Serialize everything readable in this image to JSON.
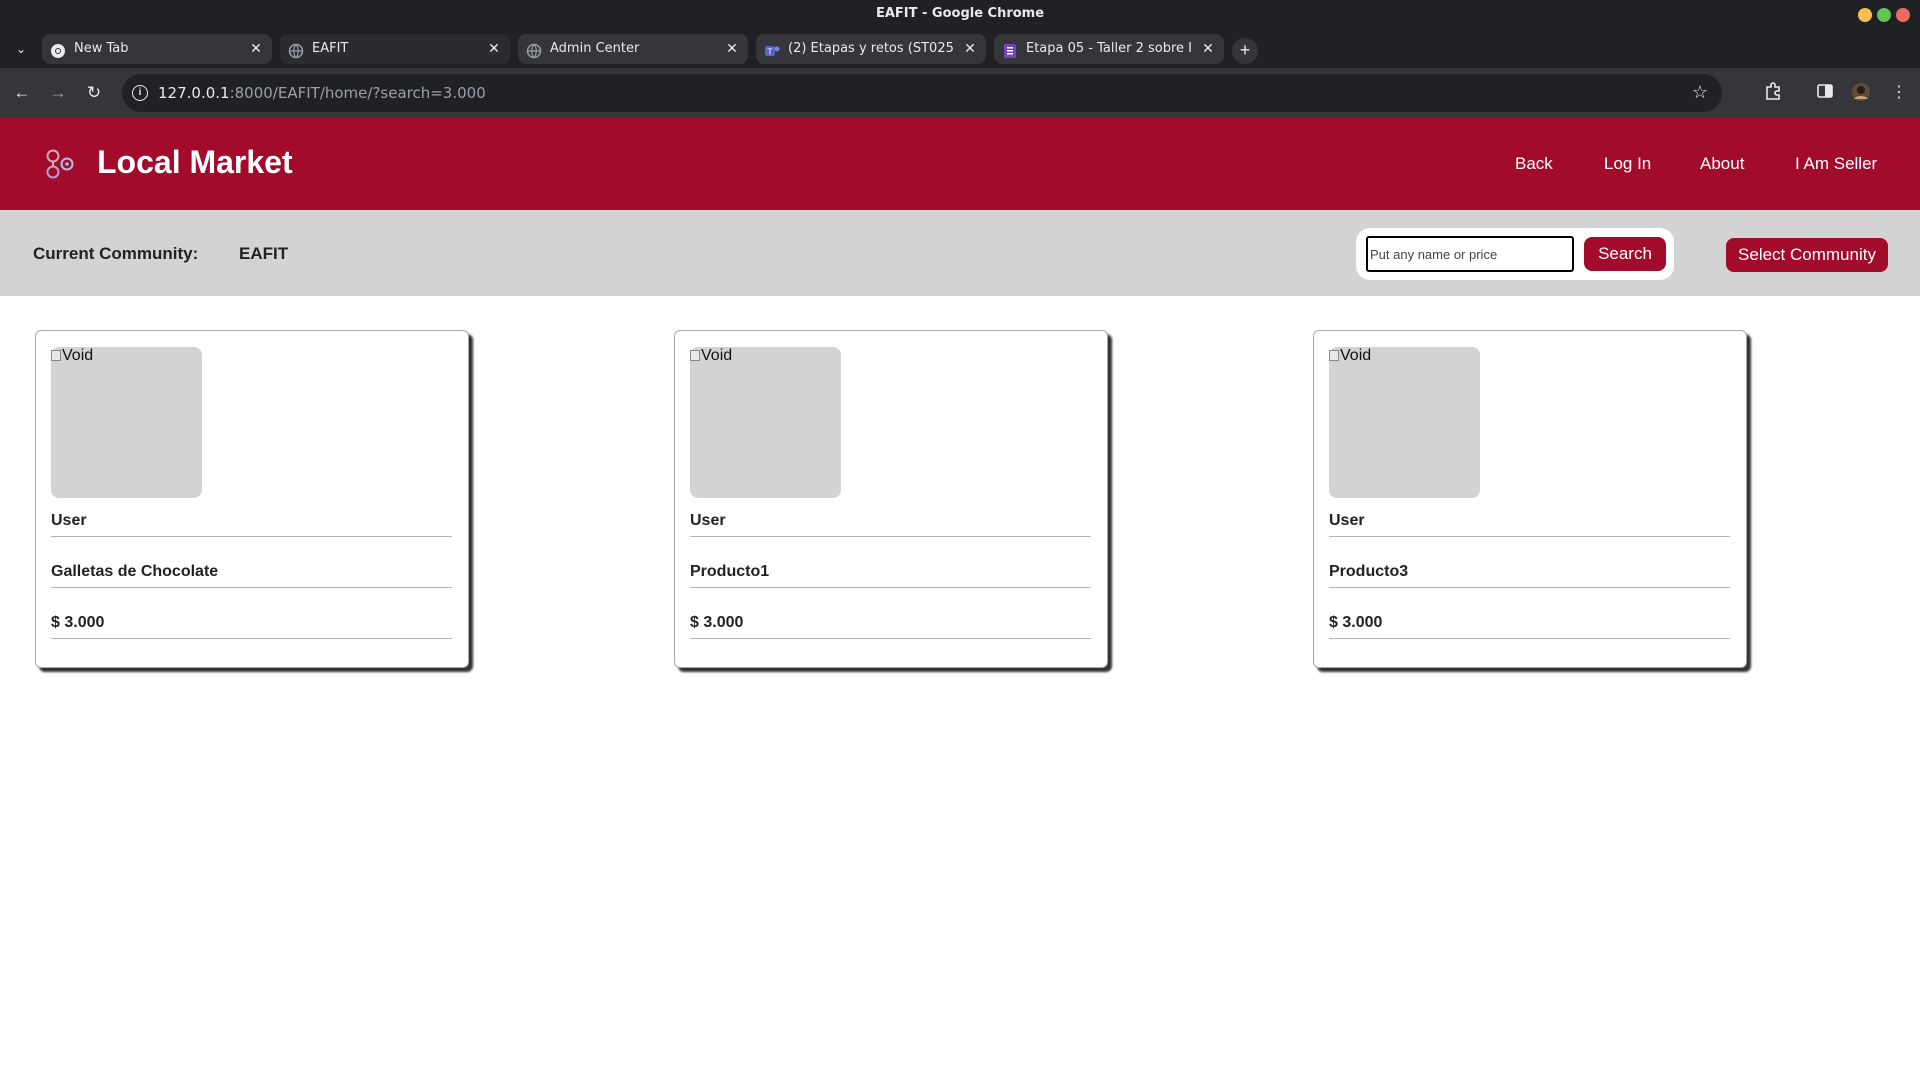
{
  "browser": {
    "window_title": "EAFIT - Google Chrome",
    "tabs": [
      {
        "label": "New Tab",
        "favicon": "chrome-icon",
        "active": false
      },
      {
        "label": "EAFIT",
        "favicon": "globe-icon",
        "active": true
      },
      {
        "label": "Admin Center",
        "favicon": "globe-icon",
        "active": false
      },
      {
        "label": "(2) Etapas y retos (ST025",
        "favicon": "teams-icon",
        "active": false
      },
      {
        "label": "Etapa 05 - Taller 2 sobre I",
        "favicon": "forms-icon",
        "active": false
      }
    ],
    "url_host": "127.0.0.1",
    "url_rest": ":8000/EAFIT/home/?search=3.000"
  },
  "site": {
    "title": "Local Market",
    "nav": [
      {
        "label": "Back"
      },
      {
        "label": "Log In"
      },
      {
        "label": "About"
      },
      {
        "label": "I Am Seller"
      }
    ],
    "colors": {
      "brand": "#a20b2b",
      "subbar": "#d3d3d3"
    }
  },
  "community_bar": {
    "label": "Current Community:",
    "value": "EAFIT",
    "search_placeholder": "Put any name or price",
    "search_value": "",
    "search_button": "Search",
    "select_button": "Select Community"
  },
  "products": [
    {
      "image_alt": "Void",
      "user": "User",
      "name": "Galletas de Chocolate",
      "price": "$ 3.000"
    },
    {
      "image_alt": "Void",
      "user": "User",
      "name": "Producto1",
      "price": "$ 3.000"
    },
    {
      "image_alt": "Void",
      "user": "User",
      "name": "Producto3",
      "price": "$ 3.000"
    }
  ]
}
